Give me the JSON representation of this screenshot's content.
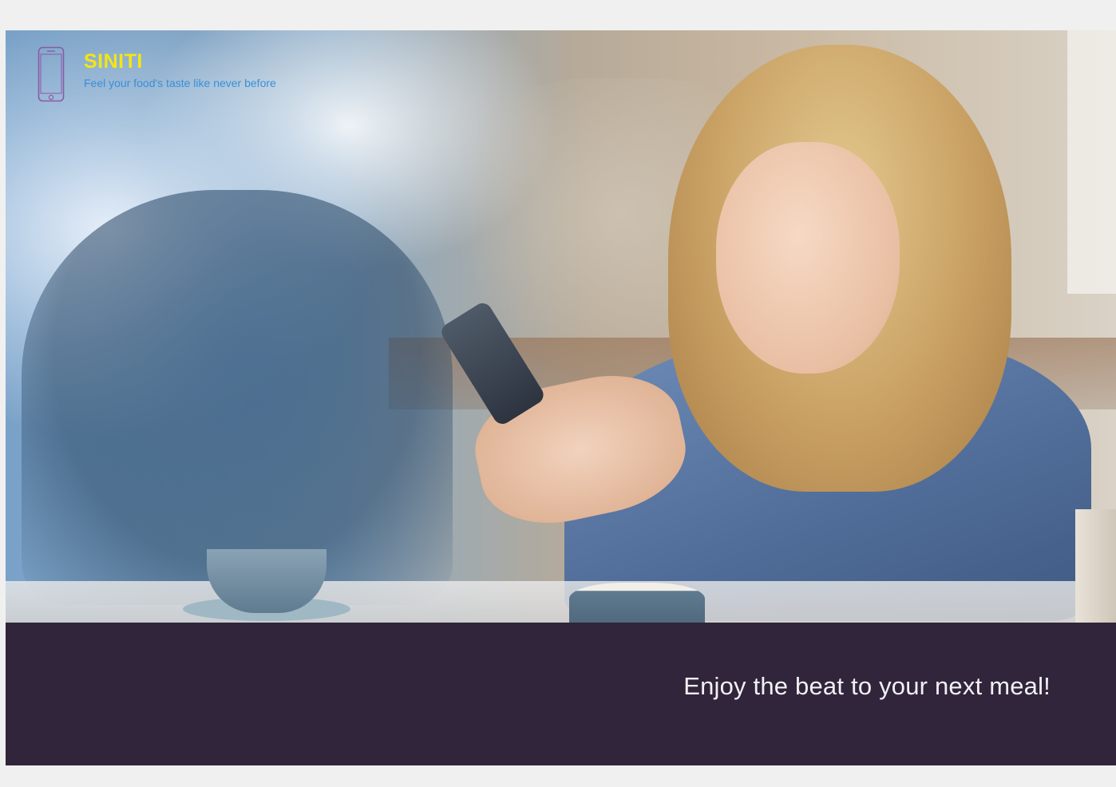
{
  "brand": {
    "name": "SINITI",
    "tagline": "Feel your food's taste like never before",
    "icon": "smartphone-icon",
    "name_color": "#f4e515",
    "tagline_color": "#3a8fd6",
    "icon_color": "#8a5aa8"
  },
  "hero": {
    "image": "woman-smiling-at-phone-in-cafe"
  },
  "footer": {
    "slogan": "Enjoy the beat to your next meal!",
    "background_color": "#30253b"
  }
}
